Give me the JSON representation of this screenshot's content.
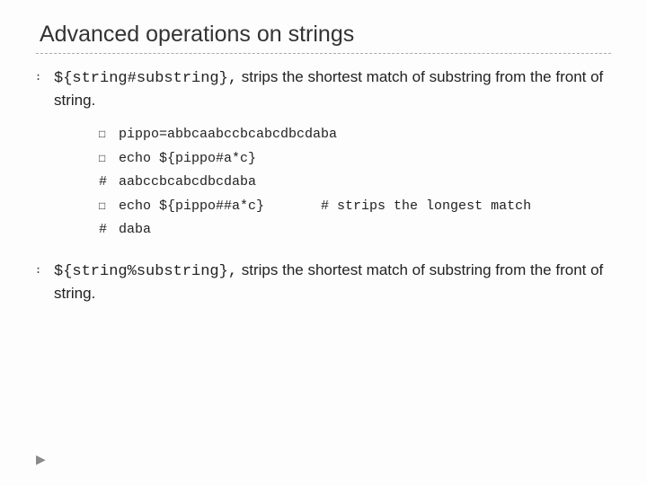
{
  "title": "Advanced operations on strings",
  "bullet_glyph": "։",
  "square_glyph": "□",
  "hash_glyph": "#",
  "arrow_glyph": "▶",
  "para1": {
    "code": "${string#substring},",
    "rest": " strips the shortest match of substring from the front of string."
  },
  "term": [
    {
      "pfx_type": "square",
      "body": "pippo=abbcaabccbcabcdbcdaba"
    },
    {
      "pfx_type": "square",
      "body": "echo ${pippo#a*c}"
    },
    {
      "pfx_type": "hash",
      "body": "aabccbcabcdbcdaba"
    },
    {
      "pfx_type": "square",
      "body": "echo ${pippo##a*c}       # strips the longest match"
    },
    {
      "pfx_type": "hash",
      "body": "daba"
    }
  ],
  "para2": {
    "code": "${string%substring},",
    "rest": " strips the shortest match of substring from the front of string."
  }
}
